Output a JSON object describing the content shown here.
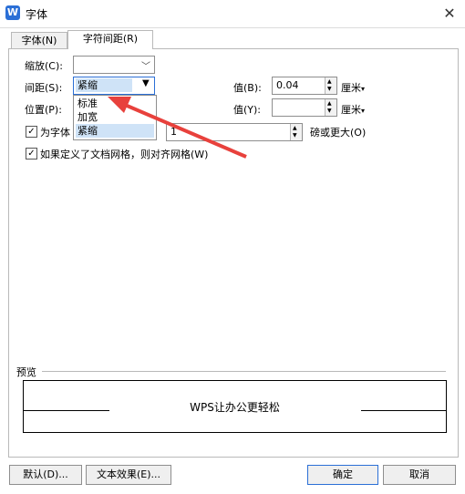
{
  "window": {
    "title": "字体",
    "app_icon": "W"
  },
  "tabs": [
    {
      "label": "字体(N)"
    },
    {
      "label": "字符间距(R)"
    }
  ],
  "form": {
    "scale_label": "缩放(C):",
    "scale_value": "",
    "spacing_label": "间距(S):",
    "spacing_value": "紧缩",
    "spacing_options": [
      "标准",
      "加宽",
      "紧缩"
    ],
    "value_b_label": "值(B):",
    "value_b": "0.04",
    "unit_b": "厘米",
    "position_label": "位置(P):",
    "value_y_label": "值(Y):",
    "value_y": "",
    "unit_y": "厘米",
    "kerning_label": "为字体",
    "kerning_value": "1",
    "kerning_suffix": "磅或更大(O)",
    "grid_label": "如果定义了文档网格，则对齐网格(W)",
    "kerning_checked": true,
    "grid_checked": true
  },
  "preview": {
    "label": "预览",
    "sample": "WPS让办公更轻松"
  },
  "buttons": {
    "default": "默认(D)...",
    "text_effect": "文本效果(E)...",
    "ok": "确定",
    "cancel": "取消"
  },
  "colors": {
    "accent": "#2b6fd6",
    "selection": "#cfe3f7",
    "arrow": "#e8413c"
  }
}
